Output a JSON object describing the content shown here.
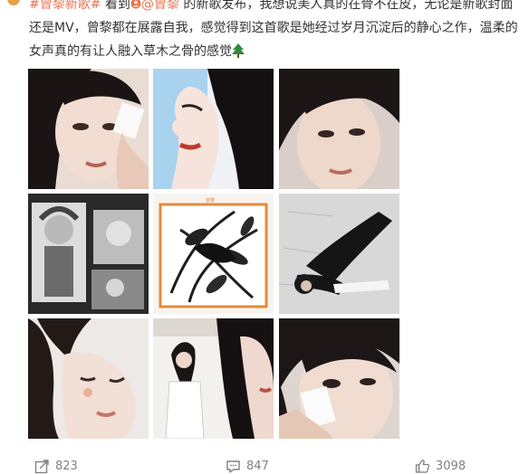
{
  "post": {
    "hashtag": "#曾黎新歌#",
    "text_1": " 看到",
    "mention": "@曾黎",
    "text_2": " 的新歌发布，我想说美人真的在骨不在皮，无论是新歌封面还是MV，曾黎都在展露自我，感觉得到这首歌是她经过岁月沉淀后的静心之作，温柔的女声真的有让人融入草木之骨的感觉",
    "emoji_icon": "tree-emoji-icon"
  },
  "grid": {
    "images": [
      {
        "name": "photo-1-wiping-cheek"
      },
      {
        "name": "photo-2-profile-blue"
      },
      {
        "name": "photo-3-closeup"
      },
      {
        "name": "photo-4-opera-collage"
      },
      {
        "name": "photo-5-album-cover"
      },
      {
        "name": "photo-6-lying-pose"
      },
      {
        "name": "photo-7-eyes-closed"
      },
      {
        "name": "photo-8-white-shirt"
      },
      {
        "name": "photo-9-tissue-eye"
      }
    ]
  },
  "actions": {
    "repost_count": "823",
    "comment_count": "847",
    "like_count": "3098"
  },
  "colors": {
    "link": "#eb7350",
    "text": "#333333",
    "muted": "#808080"
  }
}
